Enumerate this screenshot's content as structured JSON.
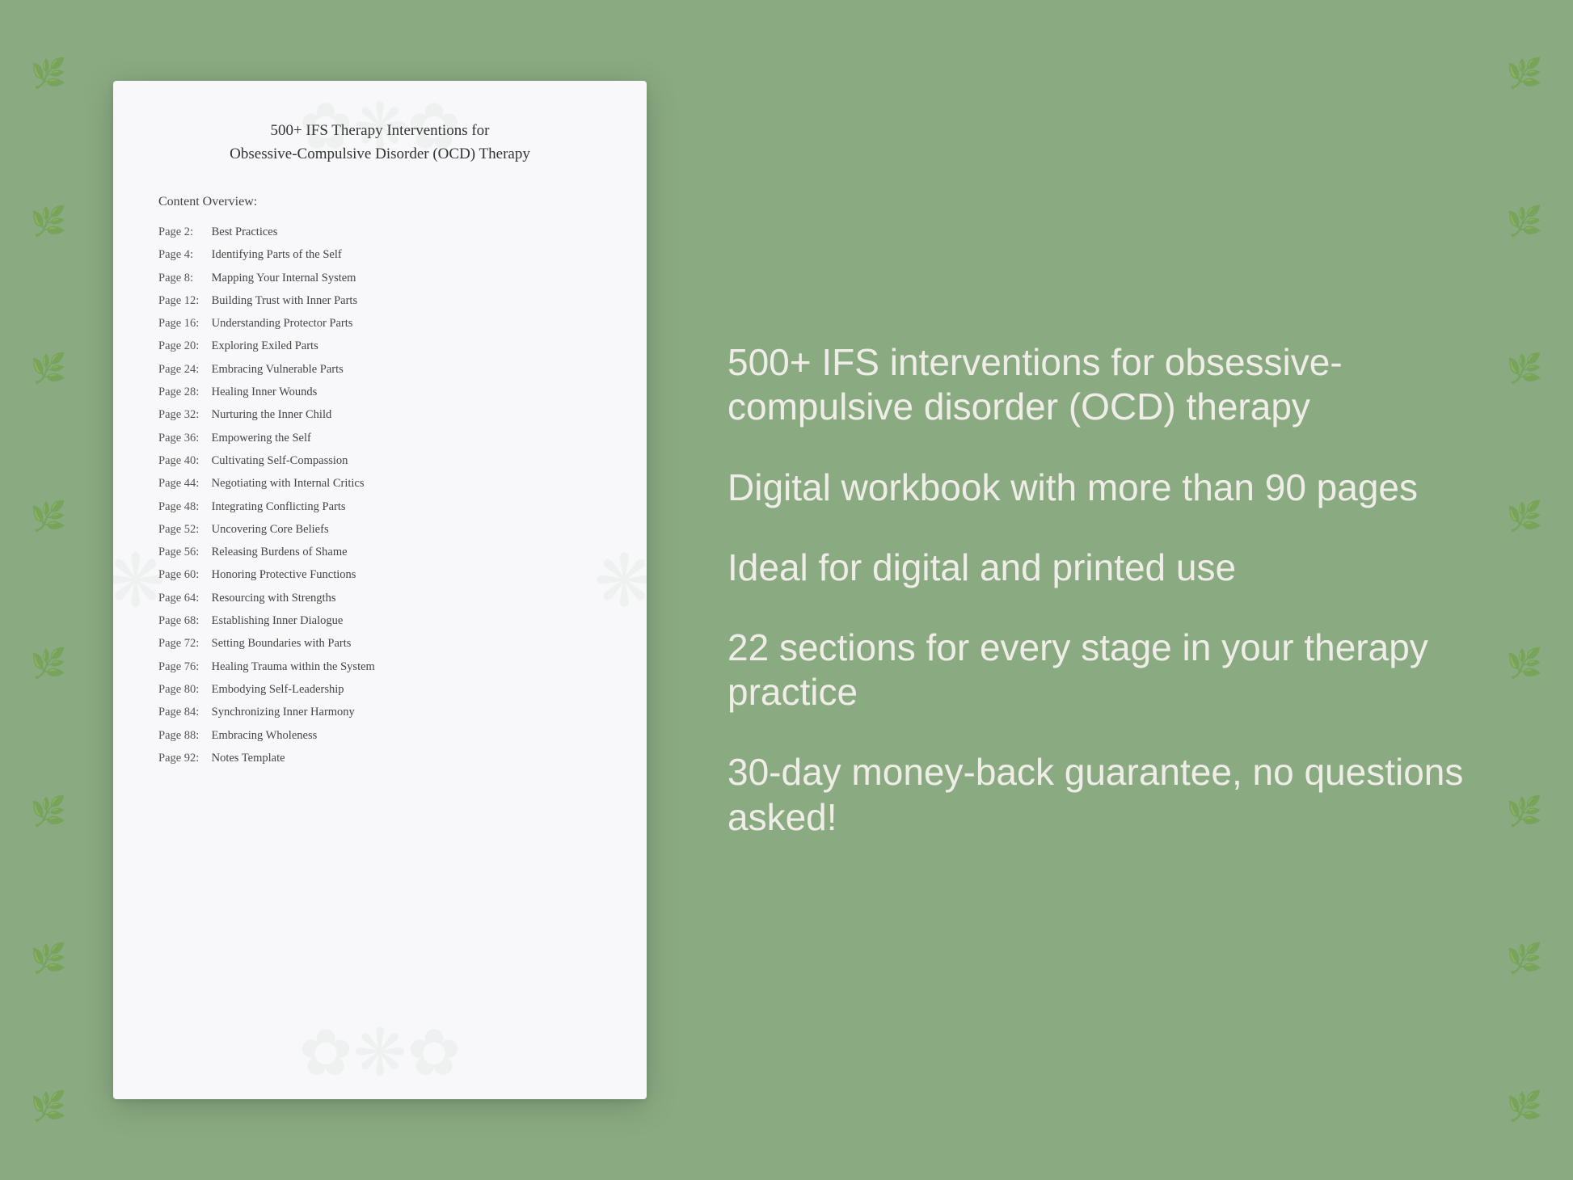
{
  "background": {
    "color": "#8aab82"
  },
  "document": {
    "title_line1": "500+ IFS Therapy Interventions for",
    "title_line2": "Obsessive-Compulsive Disorder (OCD) Therapy",
    "content_overview_label": "Content Overview:",
    "toc": [
      {
        "page": "Page  2:",
        "title": "Best Practices"
      },
      {
        "page": "Page  4:",
        "title": "Identifying Parts of the Self"
      },
      {
        "page": "Page  8:",
        "title": "Mapping Your Internal System"
      },
      {
        "page": "Page 12:",
        "title": "Building Trust with Inner Parts"
      },
      {
        "page": "Page 16:",
        "title": "Understanding Protector Parts"
      },
      {
        "page": "Page 20:",
        "title": "Exploring Exiled Parts"
      },
      {
        "page": "Page 24:",
        "title": "Embracing Vulnerable Parts"
      },
      {
        "page": "Page 28:",
        "title": "Healing Inner Wounds"
      },
      {
        "page": "Page 32:",
        "title": "Nurturing the Inner Child"
      },
      {
        "page": "Page 36:",
        "title": "Empowering the Self"
      },
      {
        "page": "Page 40:",
        "title": "Cultivating Self-Compassion"
      },
      {
        "page": "Page 44:",
        "title": "Negotiating with Internal Critics"
      },
      {
        "page": "Page 48:",
        "title": "Integrating Conflicting Parts"
      },
      {
        "page": "Page 52:",
        "title": "Uncovering Core Beliefs"
      },
      {
        "page": "Page 56:",
        "title": "Releasing Burdens of Shame"
      },
      {
        "page": "Page 60:",
        "title": "Honoring Protective Functions"
      },
      {
        "page": "Page 64:",
        "title": "Resourcing with Strengths"
      },
      {
        "page": "Page 68:",
        "title": "Establishing Inner Dialogue"
      },
      {
        "page": "Page 72:",
        "title": "Setting Boundaries with Parts"
      },
      {
        "page": "Page 76:",
        "title": "Healing Trauma within the System"
      },
      {
        "page": "Page 80:",
        "title": "Embodying Self-Leadership"
      },
      {
        "page": "Page 84:",
        "title": "Synchronizing Inner Harmony"
      },
      {
        "page": "Page 88:",
        "title": "Embracing Wholeness"
      },
      {
        "page": "Page 92:",
        "title": "Notes Template"
      }
    ]
  },
  "features": [
    {
      "text": "500+ IFS interventions for obsessive-compulsive disorder (OCD) therapy"
    },
    {
      "text": "Digital workbook with more than 90 pages"
    },
    {
      "text": "Ideal for digital and printed use"
    },
    {
      "text": "22 sections for every stage in your therapy practice"
    },
    {
      "text": "30-day money-back guarantee, no questions asked!"
    }
  ]
}
